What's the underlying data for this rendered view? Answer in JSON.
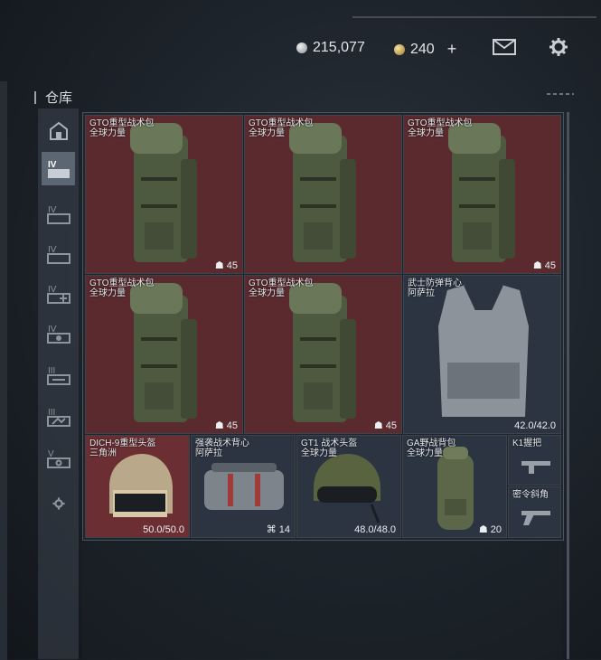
{
  "header": {
    "currency_silver": "215,077",
    "currency_gold": "240",
    "plus_label": "+",
    "mail_icon": "mail-icon",
    "settings_icon": "gear-icon"
  },
  "storage": {
    "title": "仓库",
    "items": [
      {
        "name": "GTO重型战术包",
        "sub": "全球力量",
        "value": "45",
        "value_icon": "weight-icon"
      },
      {
        "name": "GTO重型战术包",
        "sub": "全球力量",
        "value": "",
        "value_icon": ""
      },
      {
        "name": "GTO重型战术包",
        "sub": "全球力量",
        "value": "45",
        "value_icon": "weight-icon"
      },
      {
        "name": "GTO重型战术包",
        "sub": "全球力量",
        "value": "45",
        "value_icon": "weight-icon"
      },
      {
        "name": "GTO重型战术包",
        "sub": "全球力量",
        "value": "45",
        "value_icon": "weight-icon"
      },
      {
        "name": "武士防弹背心",
        "sub": "阿萨拉",
        "value": "42.0/42.0",
        "value_icon": ""
      },
      {
        "name": "DICH-9重型头盔",
        "sub": "三角洲",
        "value": "50.0/50.0",
        "value_icon": ""
      },
      {
        "name": "强袭战术背心",
        "sub": "阿萨拉",
        "value": "14",
        "value_icon": "vest-slot-icon"
      },
      {
        "name": "GT1 战术头盔",
        "sub": "全球力量",
        "value": "48.0/48.0",
        "value_icon": ""
      },
      {
        "name": "GA野战背包",
        "sub": "全球力量",
        "value": "20",
        "value_icon": "weight-icon"
      },
      {
        "name": "K1握把",
        "sub": "",
        "value": "",
        "value_icon": ""
      },
      {
        "name": "密令斜角",
        "sub": "",
        "value": "",
        "value_icon": ""
      }
    ]
  },
  "sidebar": {
    "items": [
      {
        "icon": "home-icon"
      },
      {
        "icon": "level-iv-icon",
        "label": "IV"
      },
      {
        "icon": "level-iv-icon-2",
        "label": "IV"
      },
      {
        "icon": "level-iv-icon-3",
        "label": "IV"
      },
      {
        "icon": "level-iv-icon-4",
        "label": "IV"
      },
      {
        "icon": "level-iv-icon-5",
        "label": "IV"
      },
      {
        "icon": "level-iii-icon",
        "label": "III"
      },
      {
        "icon": "level-iii-icon-2",
        "label": "III"
      },
      {
        "icon": "level-v-icon",
        "label": "V"
      },
      {
        "icon": "gear-icon"
      }
    ]
  }
}
